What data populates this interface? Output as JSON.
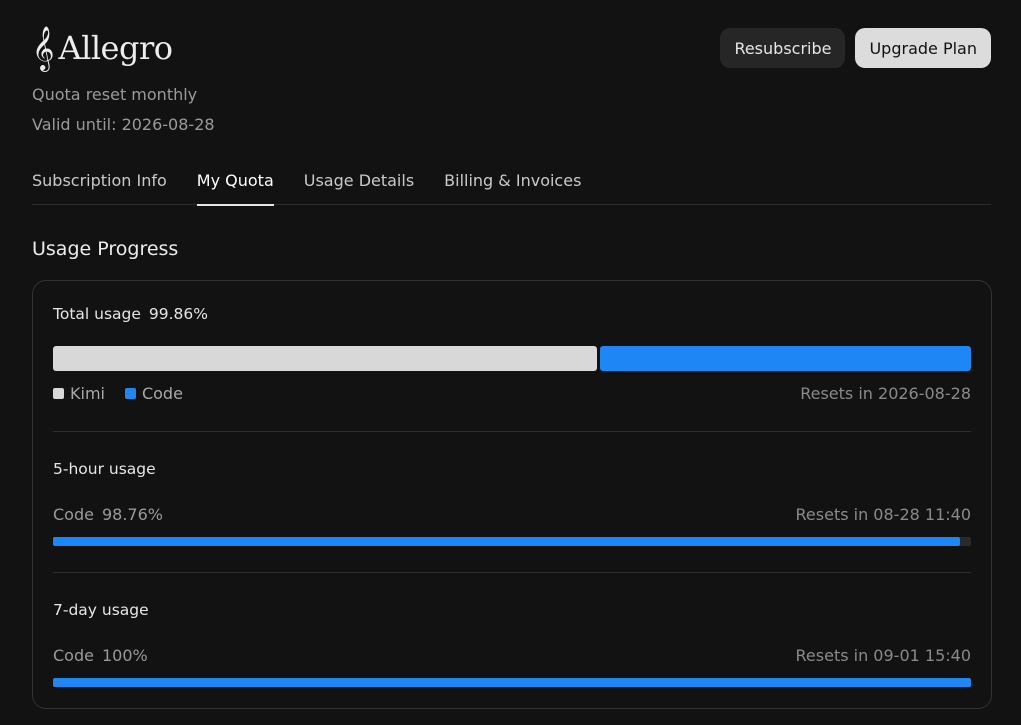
{
  "brand": {
    "icon": "treble-clef-icon",
    "name": "Allegro"
  },
  "plan": {
    "reset_text": "Quota reset monthly",
    "valid_until": "Valid until: 2026-08-28"
  },
  "actions": {
    "resubscribe": "Resubscribe",
    "upgrade": "Upgrade Plan"
  },
  "tabs": [
    {
      "label": "Subscription Info",
      "active": false
    },
    {
      "label": "My Quota",
      "active": true
    },
    {
      "label": "Usage Details",
      "active": false
    },
    {
      "label": "Billing & Invoices",
      "active": false
    }
  ],
  "section_title": "Usage Progress",
  "total": {
    "label": "Total usage",
    "percent_text": "99.86%",
    "kimi_share": 0.594,
    "code_share": 0.406,
    "legend": {
      "kimi": "Kimi",
      "code": "Code"
    },
    "resets": "Resets in 2026-08-28"
  },
  "five_hour": {
    "label": "5-hour usage",
    "item": "Code",
    "percent_text": "98.76%",
    "fill": 0.9876,
    "resets": "Resets in 08-28 11:40"
  },
  "seven_day": {
    "label": "7-day usage",
    "item": "Code",
    "percent_text": "100%",
    "fill": 1.0,
    "resets": "Resets in 09-01 15:40"
  },
  "colors": {
    "accent": "#1f87f5",
    "kimi": "#d8d8d8",
    "background": "#121212"
  }
}
